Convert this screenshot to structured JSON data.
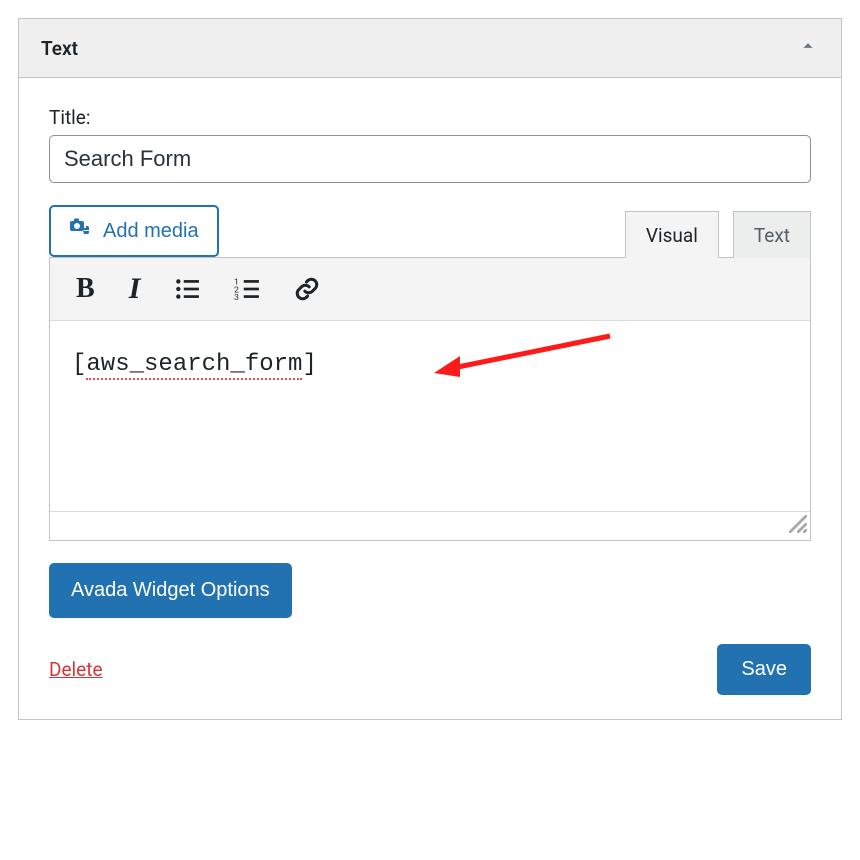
{
  "widget": {
    "title": "Text",
    "collapsed": false
  },
  "form": {
    "title_label": "Title:",
    "title_value": "Search Form",
    "add_media_label": "Add media",
    "tabs": {
      "visual": "Visual",
      "text": "Text",
      "active": "visual"
    },
    "content_shortcode": "[aws_search_form]",
    "avada_button": "Avada Widget Options",
    "delete_label": "Delete",
    "save_label": "Save"
  },
  "annotation": {
    "kind": "arrow",
    "color": "#ff1a1a",
    "points_to": "shortcode"
  }
}
